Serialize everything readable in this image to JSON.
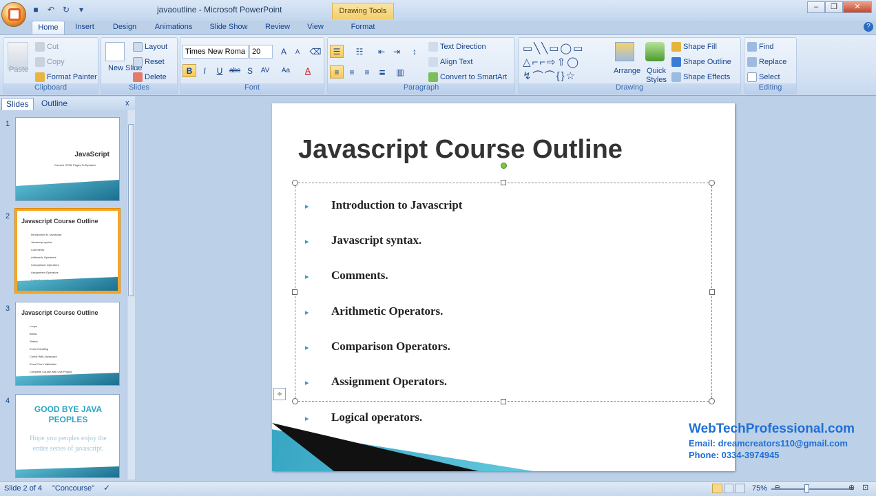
{
  "window": {
    "title": "javaoutline - Microsoft PowerPoint",
    "context_tab": "Drawing Tools"
  },
  "qat": {
    "save": "save-icon",
    "undo": "undo-icon",
    "redo": "redo-icon",
    "customize": "▾"
  },
  "tabs": [
    "Home",
    "Insert",
    "Design",
    "Animations",
    "Slide Show",
    "Review",
    "View",
    "Format"
  ],
  "clipboard": {
    "paste": "Paste",
    "cut": "Cut",
    "copy": "Copy",
    "format_painter": "Format Painter",
    "group": "Clipboard"
  },
  "slides_group": {
    "new_slide": "New Slide",
    "layout": "Layout",
    "reset": "Reset",
    "delete": "Delete",
    "group": "Slides"
  },
  "font": {
    "family": "Times New Roma",
    "size": "20",
    "group": "Font",
    "bold": "B",
    "italic": "I",
    "underline": "U",
    "strike": "abc",
    "shadow": "S",
    "spacing": "AV",
    "case": "Aa",
    "color": "A",
    "grow": "A",
    "shrink": "A"
  },
  "paragraph": {
    "text_direction": "Text Direction",
    "align_text": "Align Text",
    "smartart": "Convert to SmartArt",
    "group": "Paragraph"
  },
  "drawing": {
    "arrange": "Arrange",
    "quick_styles": "Quick Styles",
    "shape_fill": "Shape Fill",
    "shape_outline": "Shape Outline",
    "shape_effects": "Shape Effects",
    "group": "Drawing"
  },
  "editing": {
    "find": "Find",
    "replace": "Replace",
    "select": "Select",
    "group": "Editing"
  },
  "panel": {
    "tab_slides": "Slides",
    "tab_outline": "Outline",
    "close": "x"
  },
  "thumbnails": [
    {
      "num": "1",
      "title": "JavaScript",
      "subtitle": "Convert HTML Pages To Dynamic"
    },
    {
      "num": "2",
      "title": "Javascript Course Outline",
      "lines": [
        "Introduction to Javascript",
        "Javascript syntax",
        "Comments",
        "Arithmetic Operators",
        "Comparison Operators",
        "Assignment Operators",
        "Logical operators"
      ]
    },
    {
      "num": "3",
      "title": "Javascript Course Outline",
      "lines": [
        "Loops",
        "Break",
        "Switch",
        "Event Handling",
        "Check With Javascript",
        "Event Form Validation",
        "Complete Course with Live Project"
      ]
    },
    {
      "num": "4",
      "title": "GOOD BYE JAVA PEOPLES",
      "body": "Hope you peoples enjoy the entire series of javascript."
    }
  ],
  "slide": {
    "title": "Javascript Course Outline",
    "bullets": [
      "Introduction to Javascript",
      "Javascript syntax.",
      "Comments.",
      "Arithmetic Operators.",
      "Comparison Operators.",
      "Assignment Operators.",
      "Logical operators."
    ]
  },
  "watermark": {
    "site": "WebTechProfessional.com",
    "email": "Email: dreamcreators110@gmail.com",
    "phone": "Phone: 0334-3974945"
  },
  "status": {
    "slide": "Slide 2 of 4",
    "theme": "\"Concourse\"",
    "zoom": "75%"
  }
}
